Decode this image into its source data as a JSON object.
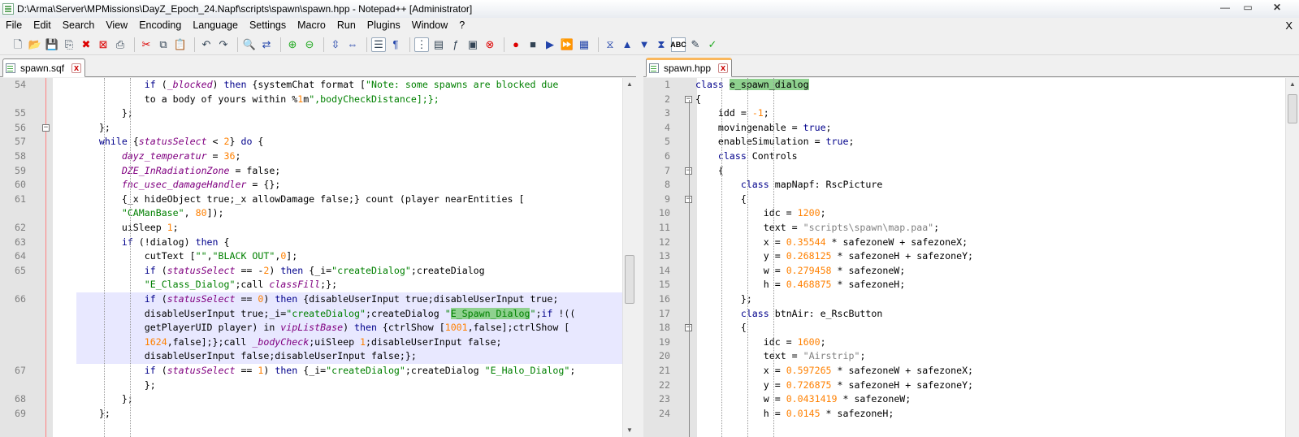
{
  "window": {
    "title": "D:\\Arma\\Server\\MPMissions\\DayZ_Epoch_24.Napf\\scripts\\spawn\\spawn.hpp - Notepad++ [Administrator]",
    "minimize": "—",
    "maximize": "▭",
    "close": "✕"
  },
  "menu": {
    "items": [
      "File",
      "Edit",
      "Search",
      "View",
      "Encoding",
      "Language",
      "Settings",
      "Macro",
      "Run",
      "Plugins",
      "Window",
      "?"
    ],
    "close_doc": "X"
  },
  "toolbar": {
    "icons": [
      "new-file",
      "open-file",
      "save",
      "save-all",
      "close",
      "close-all",
      "print",
      "cut",
      "copy",
      "paste",
      "undo",
      "redo",
      "find",
      "replace",
      "zoom-in",
      "zoom-out",
      "sync-vertical",
      "sync-horizontal",
      "word-wrap",
      "show-all-chars",
      "indent-guide",
      "doc-map",
      "function-list",
      "folder-workspace",
      "record-macro",
      "stop-macro",
      "play-macro",
      "run-macro-multiple",
      "save-macro",
      "fold-all",
      "up",
      "down",
      "unfold-all",
      "spell-check",
      "spell-options",
      "spell-next"
    ]
  },
  "left_tab": {
    "label": "spawn.sqf"
  },
  "right_tab": {
    "label": "spawn.hpp"
  },
  "left_editor": {
    "line_numbers": [
      "54",
      "",
      "55",
      "56",
      "57",
      "58",
      "59",
      "60",
      "61",
      "",
      "62",
      "63",
      "64",
      "65",
      "",
      "66",
      "",
      "",
      "",
      "",
      "67",
      "",
      "68",
      "69"
    ],
    "lines": [
      "            if (_blocked) then {systemChat format [\"Note: some spawns are blocked due",
      "            to a body of yours within %1m\",bodyCheckDistance];};",
      "        };",
      "    };",
      "    while {statusSelect < 2} do {",
      "        dayz_temperatur = 36;",
      "        DZE_InRadiationZone = false;",
      "        fnc_usec_damageHandler = {};",
      "        {_x hideObject true;_x allowDamage false;} count (player nearEntities [",
      "        \"CAManBase\", 80]);",
      "        uiSleep 1;",
      "        if (!dialog) then {",
      "            cutText [\"\",\"BLACK OUT\",0];",
      "            if (statusSelect == -2) then {_i=\"createDialog\";createDialog",
      "            \"E_Class_Dialog\";call classFill;};",
      "            if (statusSelect == 0) then {disableUserInput true;disableUserInput true;",
      "            disableUserInput true;_i=\"createDialog\";createDialog \"E_Spawn_Dialog\";if !((",
      "            getPlayerUID player) in vipListBase) then {ctrlShow [1001,false];ctrlShow [",
      "            1624,false];};call _bodyCheck;uiSleep 1;disableUserInput false;",
      "            disableUserInput false;disableUserInput false;};",
      "            if (statusSelect == 1) then {_i=\"createDialog\";createDialog \"E_Halo_Dialog\";",
      "            };",
      "        };",
      "    };"
    ]
  },
  "right_editor": {
    "line_numbers": [
      "1",
      "2",
      "3",
      "4",
      "5",
      "6",
      "7",
      "8",
      "9",
      "10",
      "11",
      "12",
      "13",
      "14",
      "15",
      "16",
      "17",
      "18",
      "19",
      "20",
      "21",
      "22",
      "23",
      "24"
    ],
    "lines": [
      "class e_spawn_dialog",
      "{",
      "    idd = -1;",
      "    movingenable = true;",
      "    enableSimulation = true;",
      "    class Controls",
      "    {",
      "        class mapNapf: RscPicture",
      "        {",
      "            idc = 1200;",
      "            text = \"scripts\\spawn\\map.paa\";",
      "            x = 0.35544 * safezoneW + safezoneX;",
      "            y = 0.268125 * safezoneH + safezoneY;",
      "            w = 0.279458 * safezoneW;",
      "            h = 0.468875 * safezoneH;",
      "        };",
      "        class btnAir: e_RscButton",
      "        {",
      "            idc = 1600;",
      "            text = \"Airstrip\";",
      "            x = 0.597265 * safezoneW + safezoneX;",
      "            y = 0.726875 * safezoneH + safezoneY;",
      "            w = 0.0431419 * safezoneW;",
      "            h = 0.0145 * safezoneH;"
    ]
  },
  "colors": {
    "keyword": "#0000ff",
    "number": "#ff8000",
    "string": "#808080",
    "variable": "#800080",
    "match_highlight": "#8fd18f",
    "selected_line": "#e8e8ff",
    "active_tab_accent": "#fab75c"
  }
}
